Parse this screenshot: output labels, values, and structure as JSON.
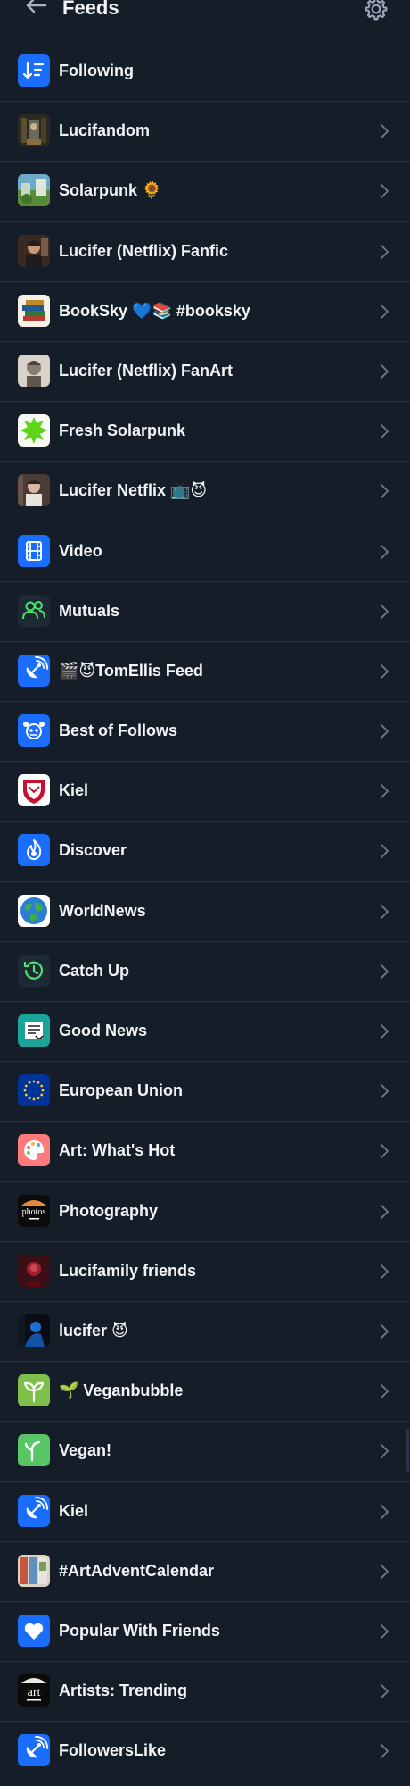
{
  "header": {
    "title": "Feeds"
  },
  "feeds": [
    {
      "label": "Following",
      "icon": "sort-arrows-icon"
    },
    {
      "label": "Lucifandom",
      "icon": "lucifandom-avatar"
    },
    {
      "label": "Solarpunk 🌻",
      "icon": "solarpunk-avatar"
    },
    {
      "label": "Lucifer (Netflix) Fanfic",
      "icon": "lucifer-fanfic-avatar"
    },
    {
      "label": "BookSky 💙📚 #booksky",
      "icon": "books-icon"
    },
    {
      "label": "Lucifer (Netflix) FanArt",
      "icon": "lucifer-fanart-avatar"
    },
    {
      "label": "Fresh Solarpunk",
      "icon": "green-star-icon"
    },
    {
      "label": "Lucifer Netflix 📺😈",
      "icon": "lucifer-netflix-avatar"
    },
    {
      "label": "Video",
      "icon": "film-icon"
    },
    {
      "label": "Mutuals",
      "icon": "people-icon"
    },
    {
      "label": "🎬😈TomEllis Feed",
      "icon": "satellite-dish-icon"
    },
    {
      "label": "Best of Follows",
      "icon": "robot-icon"
    },
    {
      "label": "Kiel",
      "icon": "kiel-crest-icon"
    },
    {
      "label": "Discover",
      "icon": "flame-icon"
    },
    {
      "label": "WorldNews",
      "icon": "globe-icon"
    },
    {
      "label": "Catch Up",
      "icon": "history-clock-icon"
    },
    {
      "label": "Good News",
      "icon": "good-news-icon"
    },
    {
      "label": "European Union",
      "icon": "eu-flag-icon"
    },
    {
      "label": "Art: What's Hot",
      "icon": "palette-icon"
    },
    {
      "label": "Photography",
      "icon": "photos-icon"
    },
    {
      "label": "Lucifamily friends",
      "icon": "lucifamily-avatar"
    },
    {
      "label": "lucifer 😈",
      "icon": "lucifer-silhouette-avatar"
    },
    {
      "label": "🌱 Veganbubble",
      "icon": "sprout-icon"
    },
    {
      "label": "Vegan!",
      "icon": "vegan-sprout-icon"
    },
    {
      "label": "Kiel",
      "icon": "satellite-dish-icon"
    },
    {
      "label": "#ArtAdventCalendar",
      "icon": "art-advent-avatar"
    },
    {
      "label": "Popular With Friends",
      "icon": "heart-icon"
    },
    {
      "label": "Artists: Trending",
      "icon": "art-icon"
    },
    {
      "label": "FollowersLike",
      "icon": "satellite-dish-icon"
    }
  ],
  "colors": {
    "background": "#151d28",
    "divider": "#243041",
    "text": "#f2f4f7",
    "chevron": "#6f7b8b",
    "accent_blue": "#1a6dff"
  }
}
